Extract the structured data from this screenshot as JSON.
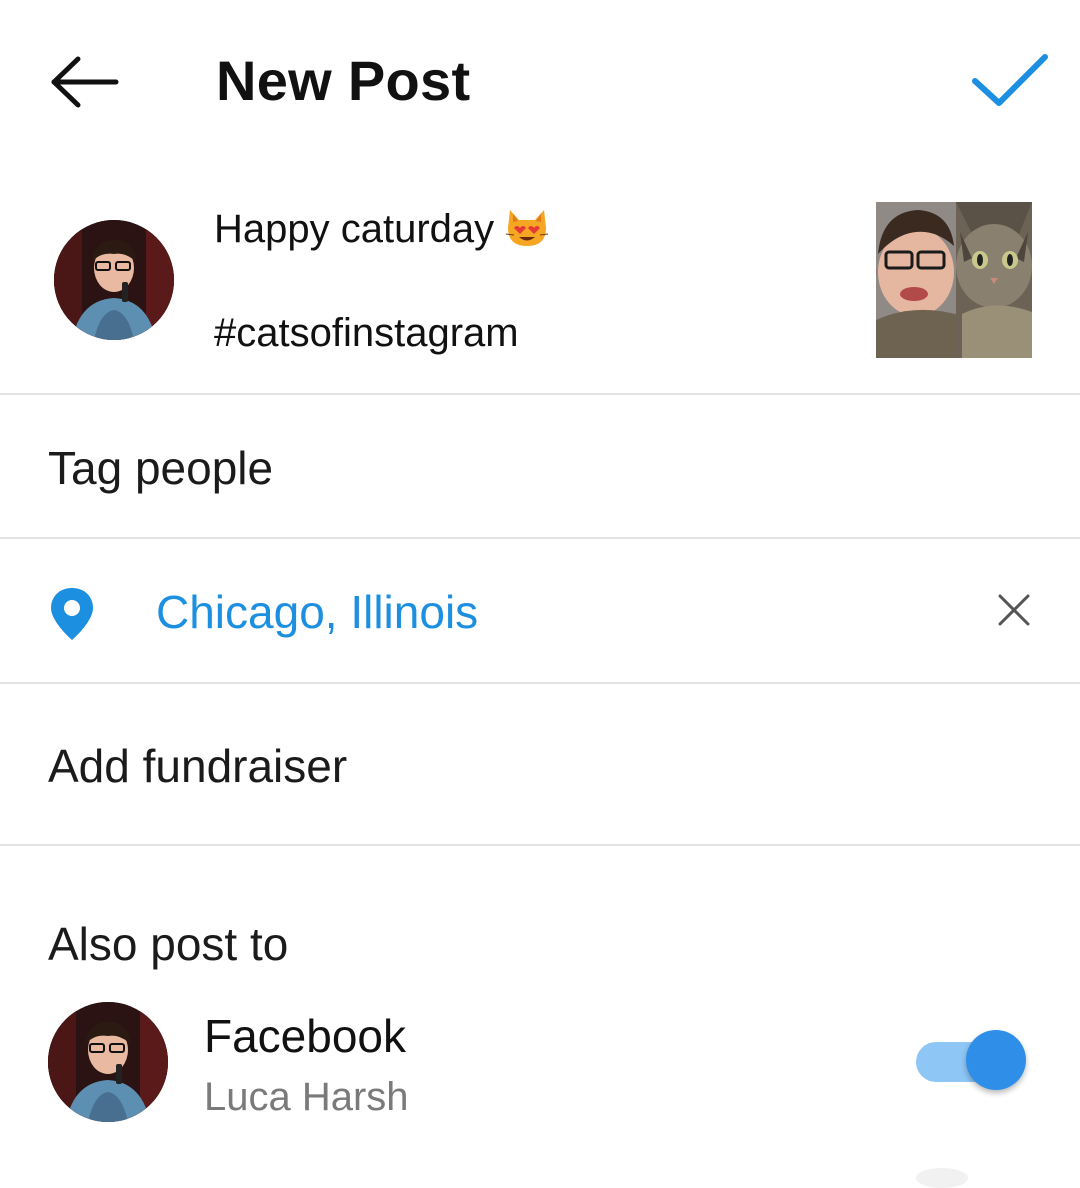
{
  "header": {
    "title": "New Post"
  },
  "composer": {
    "caption_line1": "Happy caturday",
    "caption_emoji": "smiling-cat-heart-eyes",
    "caption_line2": "#catsofinstagram"
  },
  "options": {
    "tag_people": "Tag people",
    "location": "Chicago, Illinois",
    "add_fundraiser": "Add fundraiser"
  },
  "also_post": {
    "heading": "Also post to",
    "items": [
      {
        "network": "Facebook",
        "account": "Luca Harsh",
        "enabled": true
      }
    ]
  },
  "colors": {
    "accent": "#1d8fe0",
    "toggle_on": "#2f8fe8",
    "toggle_track": "#8ec6f5",
    "divider": "#e3e3e3"
  }
}
